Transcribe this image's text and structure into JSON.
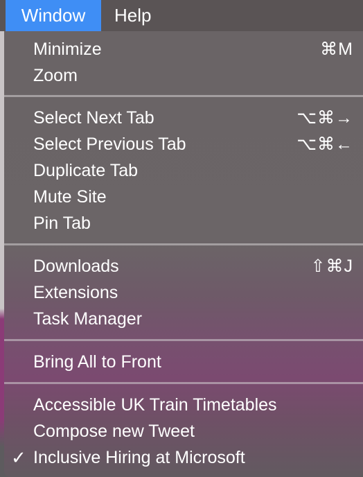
{
  "menubar": {
    "items": [
      {
        "label": "Window"
      },
      {
        "label": "Help"
      }
    ]
  },
  "menu": {
    "items": [
      {
        "label": "Minimize",
        "shortcut": "⌘M"
      },
      {
        "label": "Zoom",
        "shortcut": ""
      },
      {
        "label": "Select Next Tab",
        "shortcut": "⌥⌘→"
      },
      {
        "label": "Select Previous Tab",
        "shortcut": "⌥⌘←"
      },
      {
        "label": "Duplicate Tab",
        "shortcut": ""
      },
      {
        "label": "Mute Site",
        "shortcut": ""
      },
      {
        "label": "Pin Tab",
        "shortcut": ""
      },
      {
        "label": "Downloads",
        "shortcut": "⇧⌘J"
      },
      {
        "label": "Extensions",
        "shortcut": ""
      },
      {
        "label": "Task Manager",
        "shortcut": ""
      },
      {
        "label": "Bring All to Front",
        "shortcut": ""
      },
      {
        "label": "Accessible UK Train Timetables",
        "shortcut": ""
      },
      {
        "label": "Compose new Tweet",
        "shortcut": ""
      },
      {
        "label": "Inclusive Hiring at Microsoft",
        "shortcut": "",
        "checked": true,
        "check_mark": "✓"
      }
    ]
  }
}
